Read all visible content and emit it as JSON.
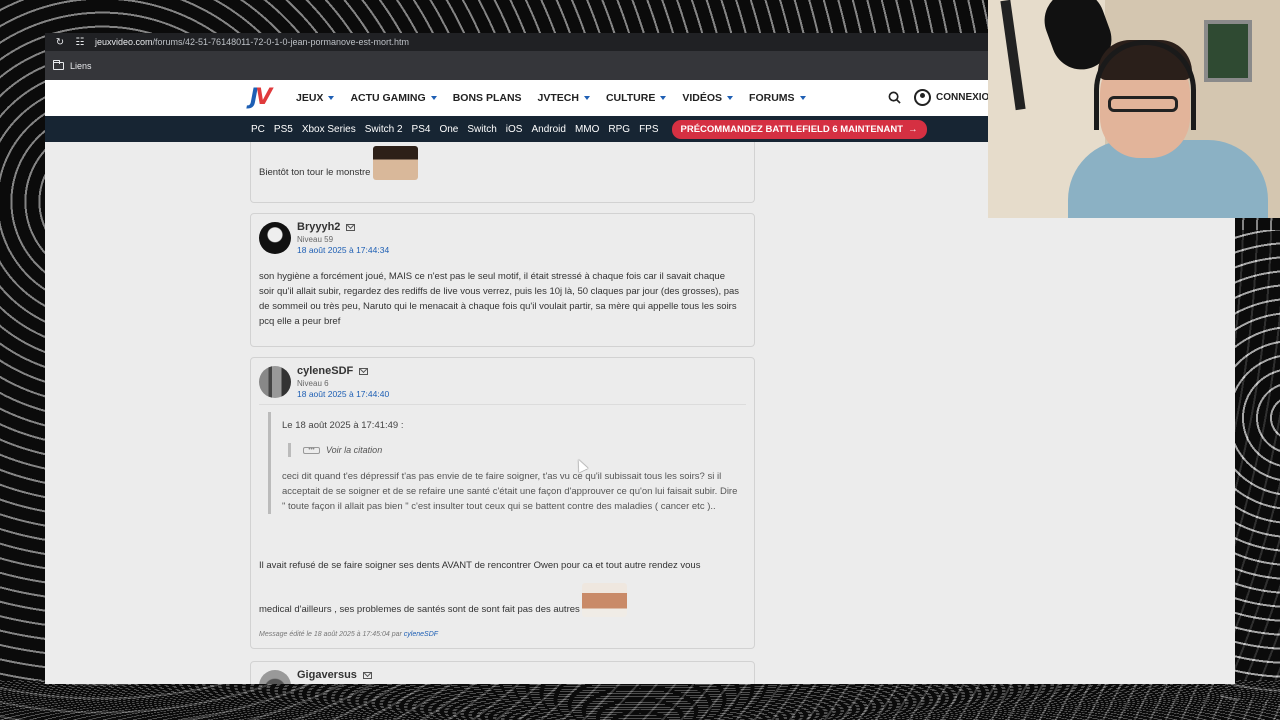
{
  "browser": {
    "url_host": "jeuxvideo.com",
    "url_path": "/forums/42-51-76148011-72-0-1-0-jean-pormanove-est-mort.htm",
    "bookmark_folder": "Liens"
  },
  "header": {
    "logo_letters": [
      "J",
      "V"
    ],
    "nav": [
      "JEUX",
      "ACTU GAMING",
      "BONS PLANS",
      "JVTECH",
      "CULTURE",
      "VIDÉOS",
      "FORUMS"
    ],
    "account_label": "CONNEXION"
  },
  "platform_bar": {
    "items": [
      "PC",
      "PS5",
      "Xbox Series",
      "Switch 2",
      "PS4",
      "One",
      "Switch",
      "iOS",
      "Android",
      "MMO",
      "RPG",
      "FPS"
    ],
    "promo": "PRÉCOMMANDEZ BATTLEFIELD 6 MAINTENANT"
  },
  "posts": [
    {
      "text": "Bientôt ton tour le monstre"
    },
    {
      "author": "Bryyyh2",
      "level": "Niveau 59",
      "date": "18 août 2025 à 17:44:34",
      "text": "son hygiène a forcément joué, MAIS ce n'est pas le seul motif, il était stressé à chaque fois car il savait chaque soir qu'il allait subir, regardez des rediffs de live vous verrez, puis les 10j là, 50 claques par jour (des grosses), pas de sommeil ou très peu, Naruto qui le menacait à chaque fois qu'il voulait partir, sa mère qui appelle tous les soirs pcq elle a peur bref"
    },
    {
      "author": "cyleneSDF",
      "level": "Niveau 6",
      "date": "18 août 2025 à 17:44:40",
      "quote_head": "Le 18 août 2025 à 17:41:49 :",
      "see_quote": "Voir la citation",
      "quote_text": "ceci dit quand t'es dépressif t'as pas envie de te faire soigner, t'as vu ce qu'il subissait tous les soirs? si il acceptait de se soigner et de se refaire une santé c'était une façon d'approuver ce qu'on lui faisait subir. Dire \" toute façon il allait pas bien \" c'est insulter tout ceux qui se battent contre des maladies ( cancer etc )..",
      "text_1": "Il avait refusé de se faire soigner ses dents AVANT de rencontrer Owen pour ca et tout autre rendez vous",
      "text_2": "medical d'ailleurs , ses problemes de santés sont de sont fait pas des autres",
      "edit_note": "Message édité le 18 août 2025 à 17:45:04 par",
      "edit_user": "cyleneSDF"
    },
    {
      "author": "Gigaversus"
    }
  ]
}
